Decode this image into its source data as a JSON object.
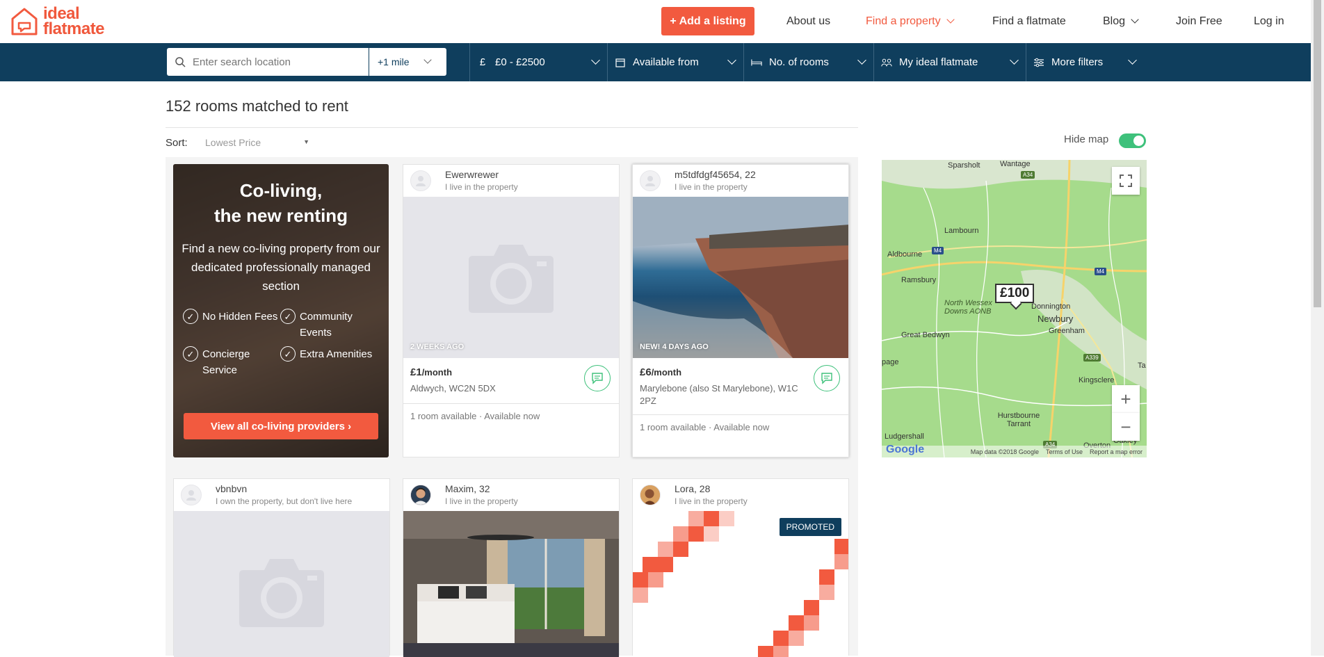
{
  "brand": {
    "logo_line1": "ideal",
    "logo_line2": "flatmate",
    "accent": "#f25a3f",
    "navy": "#0f3e5d",
    "green": "#3ec17b"
  },
  "header": {
    "add_listing": "+ Add a listing",
    "nav": [
      "About us",
      "Find a property",
      "Find a flatmate",
      "Blog",
      "Join Free",
      "Log in"
    ]
  },
  "filters": {
    "search_placeholder": "Enter search location",
    "radius": "+1 mile",
    "price": "£0 - £2500",
    "available": "Available from",
    "rooms": "No. of rooms",
    "flatmate": "My ideal flatmate",
    "more": "More filters"
  },
  "results": {
    "title": "152 rooms matched to rent",
    "sort_label": "Sort:",
    "sort_value": "Lowest Price"
  },
  "coliving": {
    "title_line1": "Co-living,",
    "title_line2": "the new renting",
    "desc": "Find a new co-living property from our dedicated professionally managed section",
    "features": [
      "No Hidden Fees",
      "Community Events",
      "Concierge Service",
      "Extra Amenities"
    ],
    "button": "View all co-living providers ›"
  },
  "listings": [
    {
      "user": "Ewerwrewer",
      "sub": "I live in the property",
      "age": "2 WEEKS AGO",
      "price": "£1",
      "per": "/month",
      "address": "Aldwych, WC2N 5DX",
      "footer": "1 room available · Available now"
    },
    {
      "user": "m5tdfdgf45654, 22",
      "sub": "I live in the property",
      "age": "NEW! 4 DAYS AGO",
      "price": "£6",
      "per": "/month",
      "address": "Marylebone (also St Marylebone), W1C 2PZ",
      "footer": "1 room available · Available now"
    },
    {
      "user": "vbnbvn",
      "sub": "I own the property, but don't live here"
    },
    {
      "user": "Maxim, 32",
      "sub": "I live in the property"
    },
    {
      "user": "Lora, 28",
      "sub": "I live in the property",
      "badge": "PROMOTED"
    }
  ],
  "map": {
    "hide_label": "Hide map",
    "pin": "£100",
    "places": [
      "Sparsholt",
      "Wantage",
      "Lambourn",
      "Aldbourne",
      "Ramsbury",
      "North Wessex Downs AONB",
      "Donnington",
      "Newbury",
      "Greenham",
      "Great Bedwyn",
      "Kingsclere",
      "Hurstbourne Tarrant",
      "Ludgershall",
      "Overton",
      "Oakley",
      "page",
      "Ta"
    ],
    "roads": [
      "A34",
      "M4",
      "M4",
      "A339",
      "A34"
    ],
    "google": "Google",
    "attribution": [
      "Map data ©2018 Google",
      "Terms of Use",
      "Report a map error"
    ]
  }
}
